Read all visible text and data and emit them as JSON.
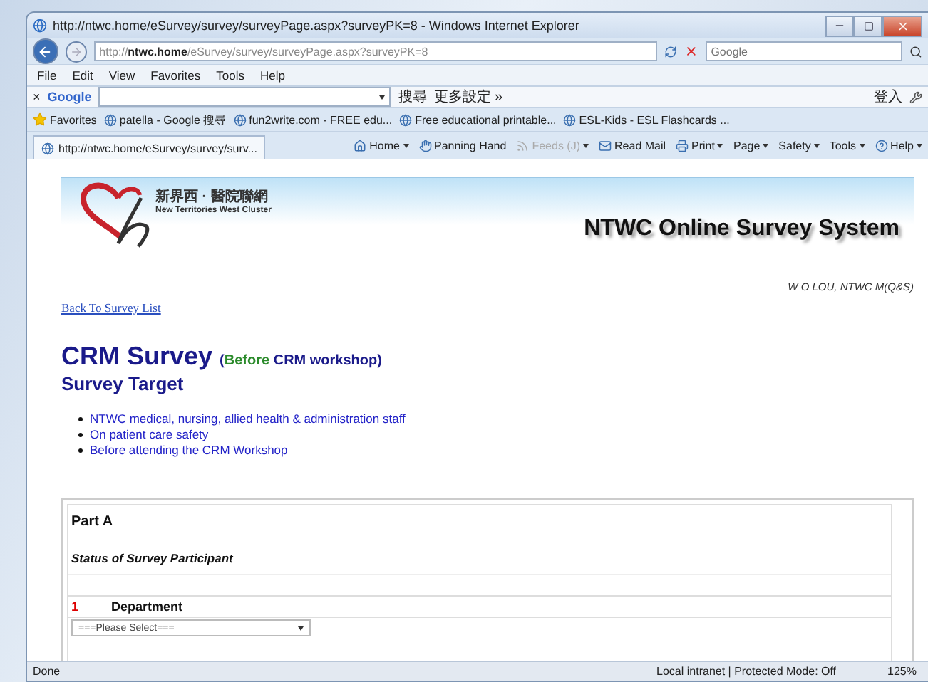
{
  "window": {
    "title": "http://ntwc.home/eSurvey/survey/surveyPage.aspx?surveyPK=8 - Windows Internet Explorer"
  },
  "address_bar": {
    "url": "http://**ntwc.home**/eSurvey/survey/surveyPage.aspx?surveyPK=8",
    "search_placeholder": "Google"
  },
  "menu": [
    "File",
    "Edit",
    "View",
    "Favorites",
    "Tools",
    "Help"
  ],
  "google_toolbar": {
    "close": "×",
    "brand": "Google",
    "search_button": "搜尋",
    "more": "更多設定 »",
    "sign_in": "登入"
  },
  "favorites_bar": {
    "label": "Favorites",
    "links": [
      "patella - Google 搜尋",
      "fun2write.com - FREE edu...",
      "Free educational printable...",
      "ESL-Kids - ESL Flashcards ..."
    ]
  },
  "tab": {
    "title": "http://ntwc.home/eSurvey/survey/surv...",
    "selected": true
  },
  "command_bar": [
    {
      "label": "Home",
      "dropdown": true,
      "disabled": false
    },
    {
      "label": "Panning Hand",
      "dropdown": false,
      "disabled": false
    },
    {
      "label": "Feeds (J)",
      "dropdown": true,
      "disabled": true
    },
    {
      "label": "Read Mail",
      "dropdown": false,
      "disabled": false
    },
    {
      "label": "Print",
      "dropdown": true,
      "disabled": false
    },
    {
      "label": "Page",
      "dropdown": true,
      "disabled": false
    },
    {
      "label": "Safety",
      "dropdown": true,
      "disabled": false
    },
    {
      "label": "Tools",
      "dropdown": true,
      "disabled": false
    },
    {
      "label": "Help",
      "dropdown": true,
      "disabled": false
    }
  ],
  "page": {
    "logo_chinese": "新界西 · 醫院聯網",
    "logo_english": "New Territories West Cluster",
    "system_title": "NTWC Online Survey System",
    "user": "W O LOU, NTWC M(Q&S)",
    "back_link": "Back To Survey List",
    "survey_title": "CRM Survey",
    "survey_subtitle": [
      {
        "text": "(",
        "kind": "plain"
      },
      {
        "text": "Before",
        "kind": "highlight"
      },
      {
        "text": " CRM workshop)",
        "kind": "plain"
      }
    ],
    "target_heading": "Survey Target",
    "targets": [
      "NTWC medical, nursing, allied health & administration staff",
      "On patient care safety",
      "Before attending the CRM Workshop"
    ],
    "part": {
      "title": "Part A",
      "section": "Status of Survey Participant",
      "questions": [
        {
          "number": "1",
          "label": "Department",
          "select": "===Please Select==="
        }
      ]
    }
  },
  "status_bar": {
    "status": "Done",
    "zone": "Local intranet | Protected Mode: Off",
    "zoom": "125%"
  }
}
